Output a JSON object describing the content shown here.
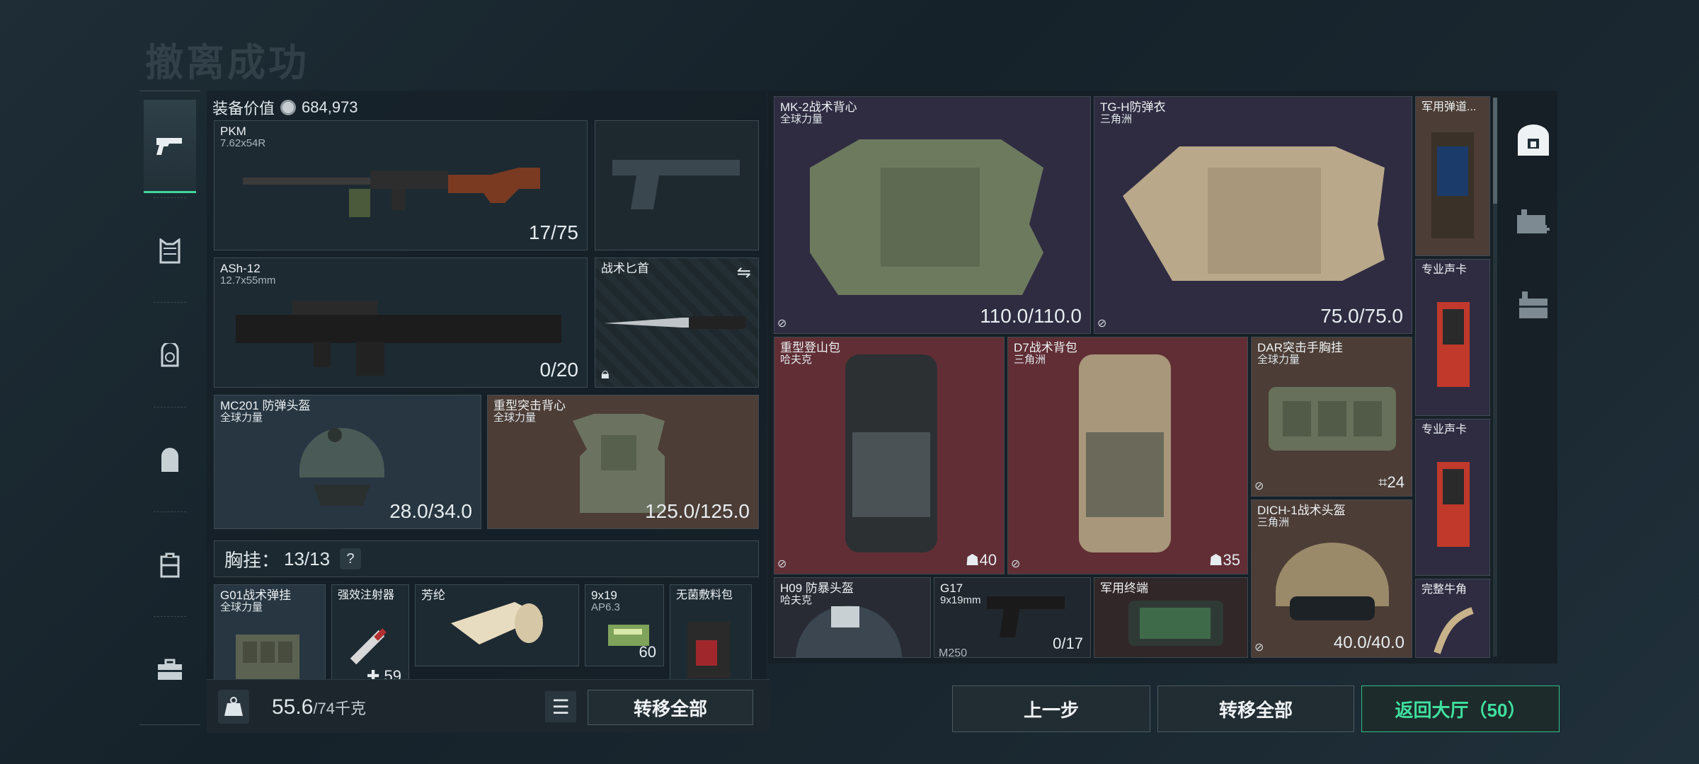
{
  "screen_title": "撤离成功",
  "equipment_value": {
    "label": "装备价值",
    "amount": "684,973"
  },
  "sidebar": {
    "items": [
      "gun-icon",
      "vest-icon",
      "helmet-backpack-icon",
      "backpack-icon",
      "case-icon",
      "toolbox-icon"
    ],
    "active_index": 0
  },
  "weapons": [
    {
      "name": "PKM",
      "ammo": "7.62x54R",
      "count": "17/75"
    },
    {
      "name": "ASh-12",
      "ammo": "12.7x55mm",
      "count": "0/20"
    }
  ],
  "knife": {
    "name": "战术匕首"
  },
  "helmet": {
    "name": "MC201 防弹头盔",
    "maker": "全球力量",
    "durability": "28.0/34.0"
  },
  "armor": {
    "name": "重型突击背心",
    "maker": "全球力量",
    "durability": "125.0/125.0"
  },
  "chest_rig": {
    "label": "胸挂：",
    "count": "13/13",
    "help": "?"
  },
  "left_items": [
    {
      "name": "G01战术弹挂",
      "maker": "全球力量"
    },
    {
      "name": "强效注射器",
      "count": "59"
    },
    {
      "name": "芳纶"
    },
    {
      "name": "9x19",
      "sub": "AP6.3",
      "count": "60"
    },
    {
      "name": "无菌敷料包"
    }
  ],
  "left_footer": {
    "weight": "55.6",
    "capacity": "/74千克",
    "transfer_all": "转移全部"
  },
  "right_items": [
    {
      "name": "MK-2战术背心",
      "maker": "全球力量",
      "durability": "110.0/110.0"
    },
    {
      "name": "TG-H防弹衣",
      "maker": "三角洲",
      "durability": "75.0/75.0"
    },
    {
      "name": "军用弹道..."
    },
    {
      "name": "专业声卡"
    },
    {
      "name": "重型登山包",
      "maker": "哈夫克",
      "count": "40"
    },
    {
      "name": "D7战术背包",
      "maker": "三角洲",
      "count": "35"
    },
    {
      "name": "DAR突击手胸挂",
      "maker": "全球力量",
      "count": "24"
    },
    {
      "name": "专业声卡"
    },
    {
      "name": "DICH-1战术头盔",
      "maker": "三角洲",
      "durability": "40.0/40.0"
    },
    {
      "name": "H09 防暴头盔",
      "maker": "哈夫克"
    },
    {
      "name": "G17",
      "sub": "9x19mm",
      "count": "0/17"
    },
    {
      "name": "军用终端"
    },
    {
      "name": "完整牛角"
    },
    {
      "name": "M250"
    }
  ],
  "bottom_buttons": {
    "back": "上一步",
    "transfer_all": "转移全部",
    "return_lobby": "返回大厅（50）"
  },
  "right_sidebar": [
    "safe-box-icon",
    "medkit-icon",
    "case-stack-icon"
  ],
  "colors": {
    "accent": "#3fe0a0",
    "red_cell": "#683036",
    "brown_cell": "#524038",
    "purple_cell": "#322e44"
  }
}
